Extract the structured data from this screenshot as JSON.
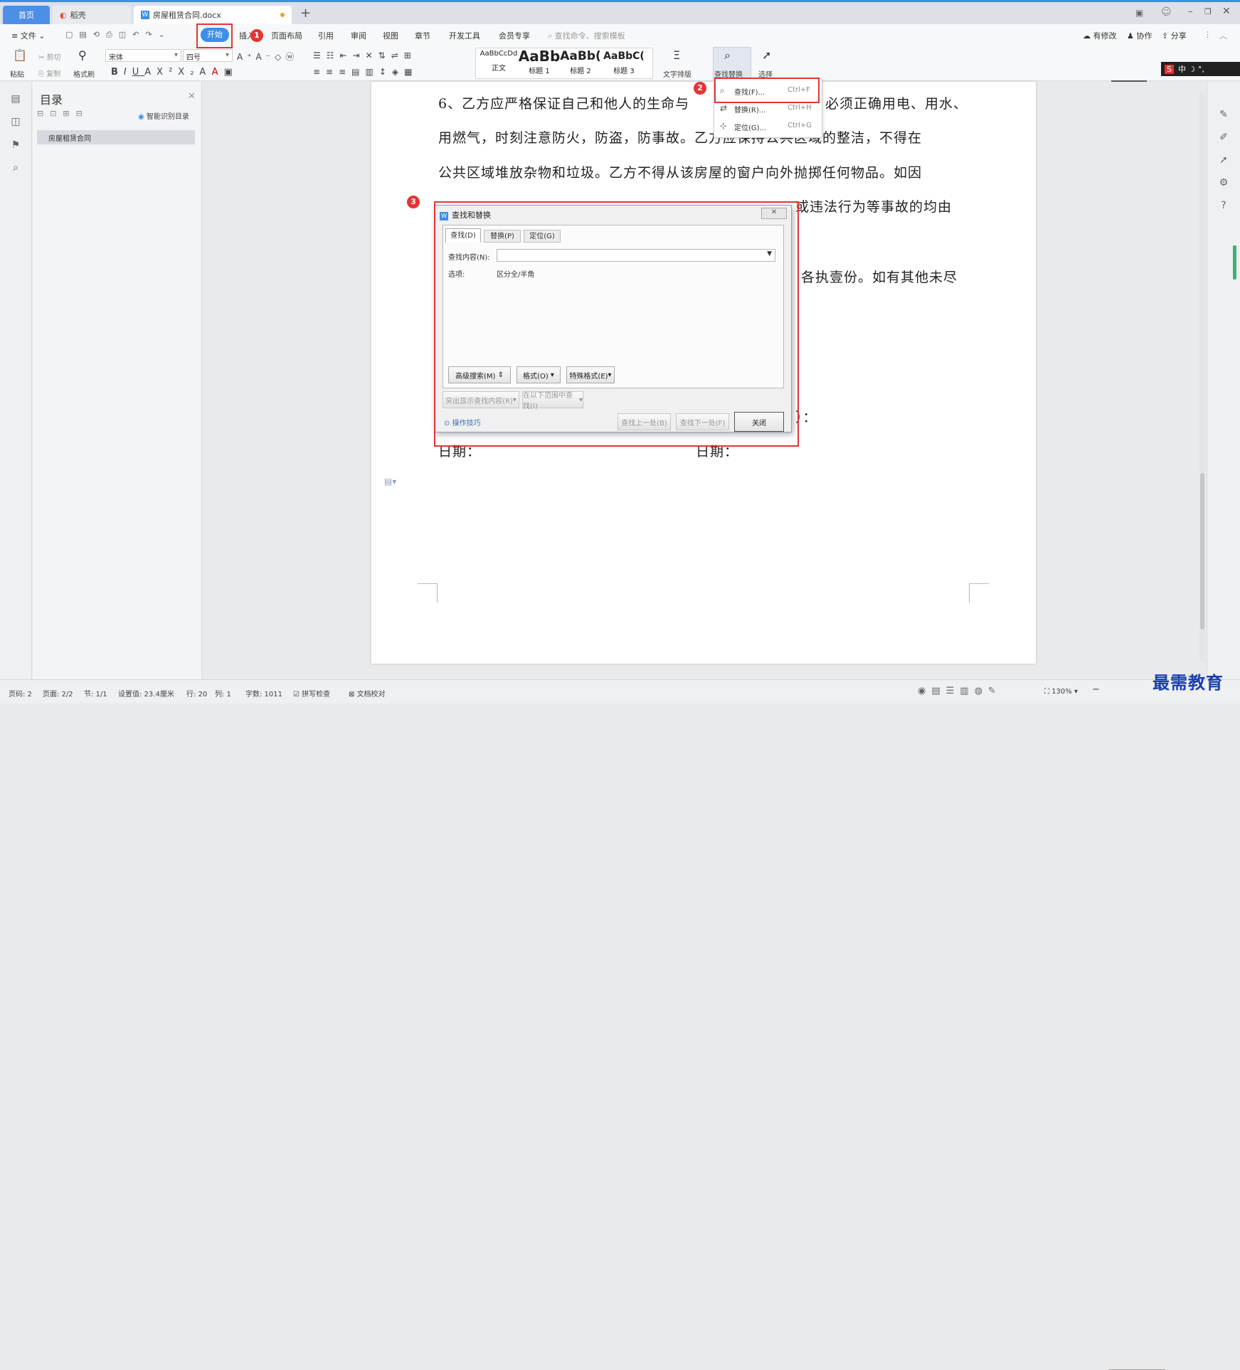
{
  "tabs": {
    "home": "首页",
    "daoke": "稻壳",
    "doc": "房屋租赁合同.docx",
    "add": "+"
  },
  "menu": {
    "file": "文件",
    "items": [
      "开始",
      "插入",
      "页面布局",
      "引用",
      "审阅",
      "视图",
      "章节",
      "开发工具",
      "会员专享"
    ],
    "search_placeholder": "查找命令、搜索模板",
    "right": [
      "有修改",
      "协作",
      "分享"
    ]
  },
  "ribbon": {
    "paste": "粘贴",
    "cut": "剪切",
    "copy": "复制",
    "format_painter": "格式刷",
    "font": "宋体",
    "size": "四号",
    "styles": [
      {
        "preview": "AaBbCcDd",
        "name": "正文"
      },
      {
        "preview": "AaBb",
        "name": "标题 1"
      },
      {
        "preview": "AaBb(",
        "name": "标题 2"
      },
      {
        "preview": "AaBbC(",
        "name": "标题 3"
      }
    ],
    "text_layout": "文字排版",
    "find_replace": "查找替换",
    "select": "选择"
  },
  "find_menu": [
    {
      "label": "查找(F)...",
      "shortcut": "Ctrl+F",
      "icon": "search-icon"
    },
    {
      "label": "替换(R)...",
      "shortcut": "Ctrl+H",
      "icon": "replace-icon"
    },
    {
      "label": "定位(G)...",
      "shortcut": "Ctrl+G",
      "icon": "goto-icon"
    }
  ],
  "toc": {
    "title": "目录",
    "smart": "智能识别目录",
    "item": "房屋租赁合同"
  },
  "document": {
    "lines": [
      "6、乙方应严格保证自己和他人的生命与",
      "必须正确用电、用水、",
      "用燃气，时刻注意防火，防盗，防事故。乙方应保持公共区域的整洁，不得在",
      "公共区域堆放杂物和垃圾。乙方不得从该房屋的窗户向外抛掷任何物品。如因",
      "或违法行为等事故的均由",
      "各执壹份。如有其他未尽",
      "）：",
      "日期：",
      "日期："
    ]
  },
  "dialog": {
    "title": "查找和替换",
    "tabs": [
      "查找(D)",
      "替换(P)",
      "定位(G)"
    ],
    "find_label": "查找内容(N):",
    "find_value": "",
    "options_label": "选项:",
    "options_value": "区分全/半角",
    "btn_advanced": "高级搜索(M)",
    "btn_format": "格式(O)",
    "btn_special": "特殊格式(E)",
    "btn_highlight": "突出显示查找内容(R)",
    "btn_scope": "在以下范围中查找(I)",
    "tips": "操作技巧",
    "btn_prev": "查找上一处(B)",
    "btn_next": "查找下一处(F)",
    "btn_close": "关闭"
  },
  "status": {
    "items": [
      "页码: 2",
      "页面: 2/2",
      "节: 1/1",
      "设置值: 23.4厘米",
      "行: 20",
      "列: 1",
      "字数: 1011",
      "拼写检查",
      "文档校对"
    ],
    "zoom": "130%"
  },
  "badges": [
    "1",
    "2",
    "3"
  ],
  "watermark": "最需教育",
  "ime": "中",
  "colors": {
    "accent": "#3d8ee8",
    "annotation": "#e53434"
  }
}
